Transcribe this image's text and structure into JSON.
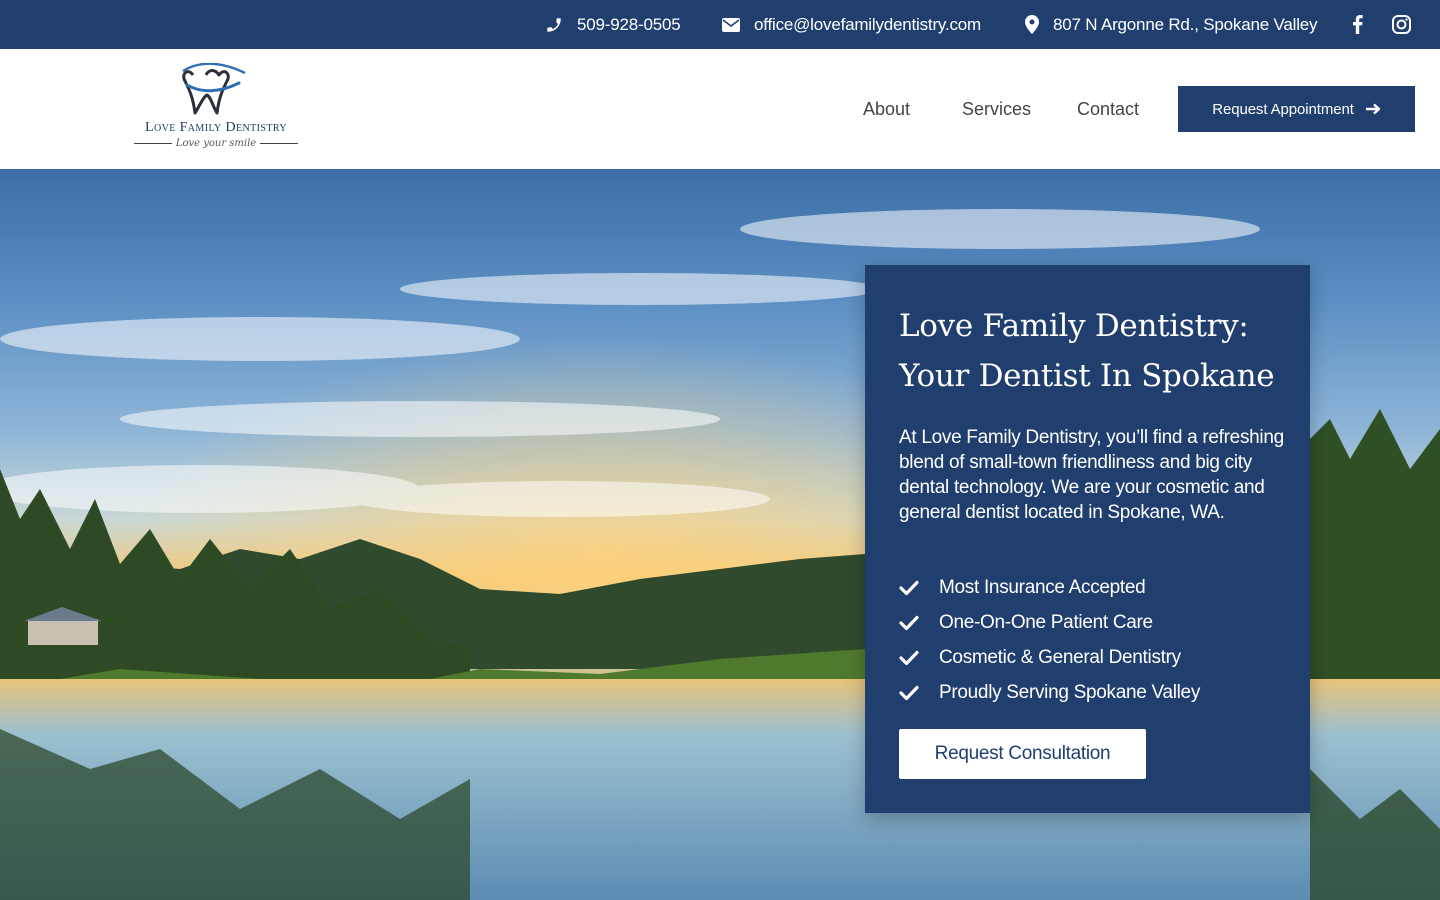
{
  "topbar": {
    "phone": "509-928-0505",
    "email": "office@lovefamilydentistry.com",
    "address": "807 N Argonne Rd., Spokane Valley",
    "icons": [
      "phone-icon",
      "envelope-icon",
      "map-pin-icon",
      "facebook-icon",
      "instagram-icon"
    ]
  },
  "logo": {
    "name": "Love Family Dentistry",
    "tagline": "Love your smile"
  },
  "nav": {
    "items": [
      {
        "label": "About"
      },
      {
        "label": "Services"
      },
      {
        "label": "Contact"
      }
    ],
    "cta_label": "Request Appointment"
  },
  "hero": {
    "title": "Love Family Dentistry: Your Dentist In Spokane",
    "description": "At Love Family Dentistry, you’ll find a refreshing blend of small-town friendliness and big city dental technology. We are your cosmetic and general dentist located in Spokane, WA.",
    "features": [
      "Most Insurance Accepted",
      "One-On-One Patient Care",
      "Cosmetic & General Dentistry",
      "Proudly Serving Spokane Valley"
    ],
    "cta_label": "Request Consultation"
  },
  "colors": {
    "brand": "#213f6e",
    "white": "#ffffff",
    "nav_text": "#444444"
  }
}
